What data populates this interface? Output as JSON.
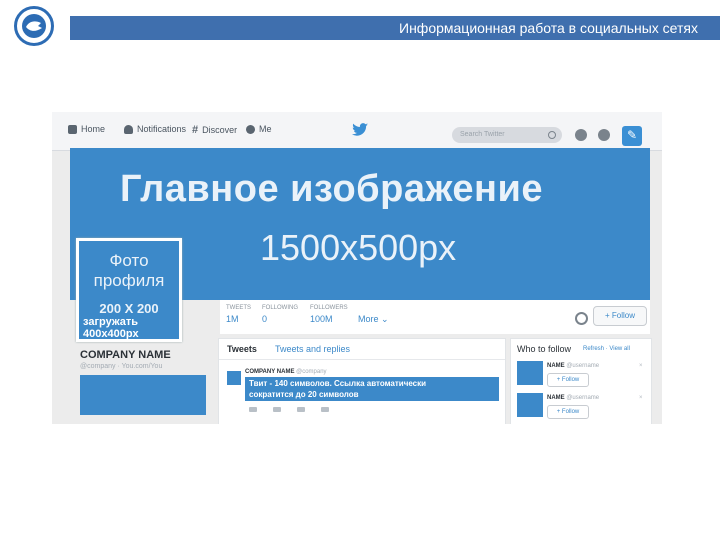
{
  "slide": {
    "title": "Информационная работа в социальных сетях",
    "logo_icon": "organization-emblem-icon"
  },
  "nav": {
    "home": "Home",
    "notifications": "Notifications",
    "discover": "Discover",
    "me": "Me",
    "search_placeholder": "Search Twitter"
  },
  "banner": {
    "line1": "Главное изображение",
    "line2": "1500x500px"
  },
  "profile": {
    "line1": "Фото",
    "line2": "профиля",
    "size": "200 X 200",
    "upload_line1": "загружать",
    "upload_line2": "400x400px"
  },
  "stats": {
    "tweets_label": "Tweets",
    "tweets_value": "1M",
    "following_label": "Following",
    "following_value": "0",
    "followers_label": "Followers",
    "followers_value": "100M",
    "more": "More",
    "follow_button": "Follow"
  },
  "company": {
    "name": "COMPANY NAME",
    "handle": "@company  ·  You.com/You"
  },
  "timeline": {
    "tab_tweets": "Tweets",
    "tab_replies": "Tweets and replies",
    "author": "COMPANY NAME",
    "author_handle": "@company",
    "tweet_line1": "Твит - 140 символов. Ссылка автоматически",
    "tweet_line2": "сократится до 20 символов"
  },
  "who_to_follow": {
    "title": "Who to follow",
    "links": "Refresh · View all",
    "row1_name": "NAME",
    "row1_handle": "@username",
    "row2_name": "NAME",
    "row2_handle": "@username",
    "follow_label": "Follow",
    "dismiss": "×"
  },
  "colors": {
    "accent_blue": "#3c89c9",
    "title_bar": "#3f6fae",
    "twitter_blue": "#55acee"
  }
}
